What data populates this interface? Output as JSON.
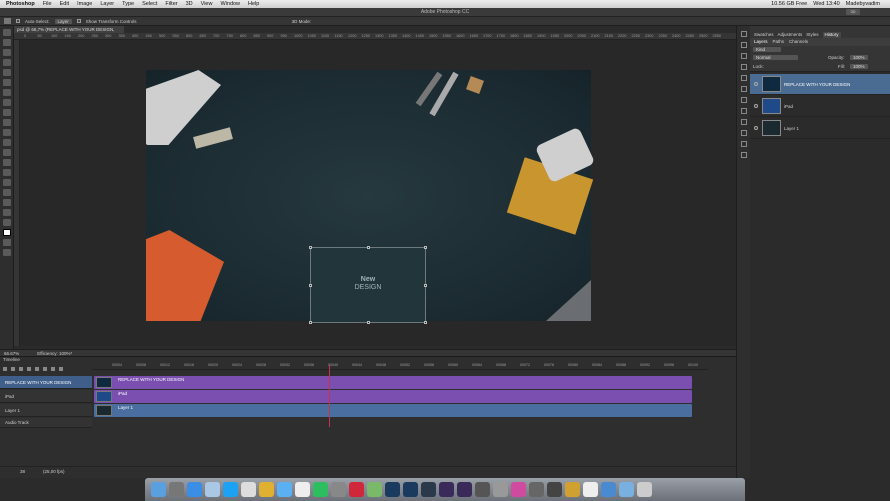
{
  "menubar": {
    "app_name": "Photoshop",
    "items": [
      "File",
      "Edit",
      "Image",
      "Layer",
      "Type",
      "Select",
      "Filter",
      "3D",
      "View",
      "Window",
      "Help"
    ],
    "right": {
      "disk": "10.56 GB Free",
      "time": "Wed 13:40",
      "user": "Madebyvadim"
    }
  },
  "window": {
    "title": "Adobe Photoshop CC",
    "workspace": "3D"
  },
  "options": {
    "auto_select_label": "Auto-Select:",
    "auto_select_value": "Layer",
    "show_transform_label": "Show Transform Controls",
    "mode_label": "3D Mode:"
  },
  "document": {
    "tab_title": "psd @ 66,7% (REPLACE WITH YOUR DESIGN, RGB/8)",
    "zoom": "66.67%",
    "efficiency": "Efficiency: 100%*"
  },
  "ruler_ticks": [
    "0",
    "50",
    "100",
    "150",
    "200",
    "250",
    "300",
    "350",
    "400",
    "450",
    "500",
    "550",
    "600",
    "650",
    "700",
    "750",
    "800",
    "850",
    "900",
    "950",
    "1000",
    "1050",
    "1100",
    "1150",
    "1200",
    "1250",
    "1300",
    "1350",
    "1400",
    "1450",
    "1500",
    "1550",
    "1600",
    "1650",
    "1700",
    "1750",
    "1800",
    "1850",
    "1900",
    "1950",
    "2000",
    "2050",
    "2100",
    "2150",
    "2200",
    "2250",
    "2300",
    "2350",
    "2400",
    "2450",
    "2500",
    "2550"
  ],
  "canvas": {
    "ipad_text_line1": "New",
    "ipad_text_line2": "DESIGN"
  },
  "timeline": {
    "title": "Timeline",
    "ruler": [
      "00004",
      "00008",
      "00012",
      "00016",
      "00020",
      "00024",
      "00028",
      "00032",
      "00036",
      "00040",
      "00044",
      "00048",
      "00052",
      "00056",
      "00060",
      "00064",
      "00068",
      "00072",
      "00076",
      "00080",
      "00084",
      "00088",
      "00092",
      "00096",
      "00100"
    ],
    "tracks": [
      {
        "label": "REPLACE WITH YOUR DESIGN",
        "clip": "REPLACE WITH YOUR DESIGN",
        "color": "#7a4fb0"
      },
      {
        "label": "iPad",
        "clip": "iPad",
        "color": "#7a4fb0"
      },
      {
        "label": "Layer 1",
        "clip": "Layer 1",
        "color": "#4a6ea0"
      }
    ],
    "audio_label": "Audio Track",
    "frame": "38",
    "fps": "(25,00 fps)"
  },
  "panels": {
    "top_tabs": [
      "Swatches",
      "Adjustments",
      "Styles",
      "History"
    ],
    "layer_tabs": [
      "Layers",
      "Paths",
      "Channels"
    ],
    "kind": "Kind",
    "blend": "Normal",
    "opacity_label": "Opacity:",
    "opacity": "100%",
    "lock_label": "Lock:",
    "fill_label": "Fill:",
    "fill": "100%",
    "layers": [
      "REPLACE WITH YOUR DESIGN",
      "iPad",
      "Layer 1"
    ]
  },
  "colors": {
    "selection": "#4a6c93",
    "clip_purple": "#7a4fb0",
    "clip_blue": "#4a6ea0",
    "playhead": "#c8334b"
  }
}
